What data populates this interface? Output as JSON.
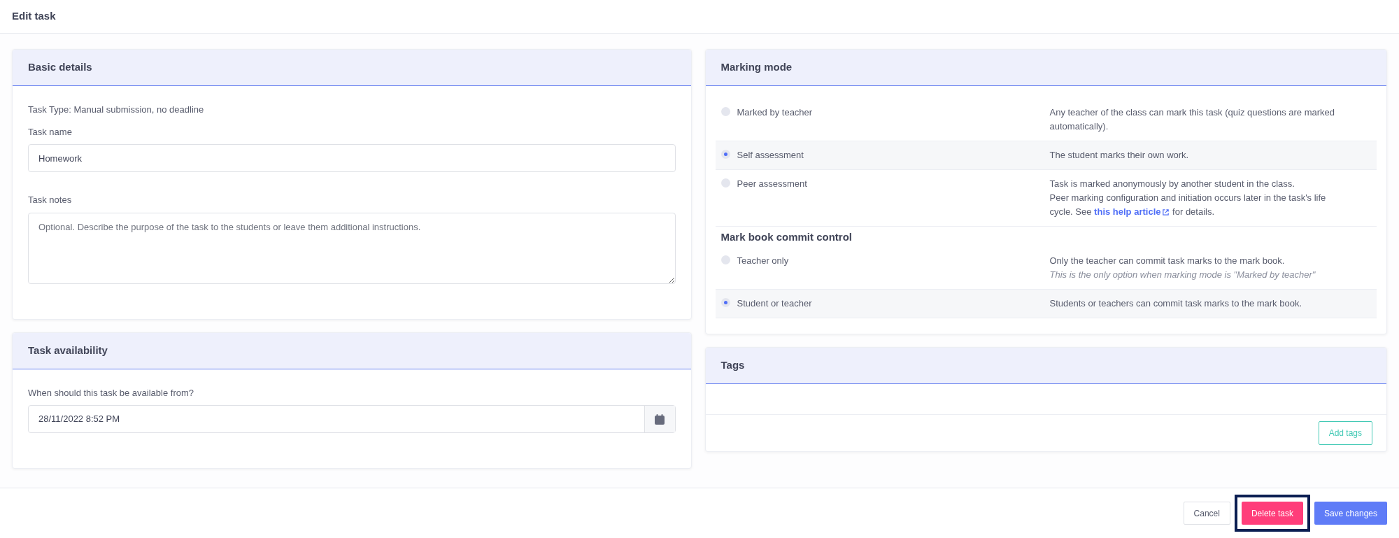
{
  "window": {
    "title": "Edit task"
  },
  "basic_details": {
    "title": "Basic details",
    "task_type": "Task Type: Manual submission, no deadline",
    "name_label": "Task name",
    "name_value": "Homework",
    "notes_label": "Task notes",
    "notes_placeholder": "Optional. Describe the purpose of the task to the students or leave them additional instructions."
  },
  "availability": {
    "title": "Task availability",
    "label": "When should this task be available from?",
    "value": "28/11/2022 8:52 PM"
  },
  "marking_mode": {
    "title": "Marking mode",
    "options": [
      {
        "label": "Marked by teacher",
        "selected": false,
        "description": "Any teacher of the class can mark this task (quiz questions are marked automatically)."
      },
      {
        "label": "Self assessment",
        "selected": true,
        "description": "The student marks their own work."
      },
      {
        "label": "Peer assessment",
        "selected": false,
        "description": "Task is marked anonymously by another student in the class.",
        "description_2": "Peer marking configuration and initiation occurs later in the task's life cycle. See",
        "link": "this help article",
        "description_after": "for details."
      }
    ],
    "commit_title": "Mark book commit control",
    "commit_options": [
      {
        "label": "Teacher only",
        "selected": false,
        "description": "Only the teacher can commit task marks to the mark book.",
        "note": "This is the only option when marking mode is \"Marked by teacher\""
      },
      {
        "label": "Student or teacher",
        "selected": true,
        "description": "Students or teachers can commit task marks to the mark book."
      }
    ]
  },
  "tags": {
    "title": "Tags",
    "add_button": "Add tags"
  },
  "footer": {
    "buttons": [
      {
        "label": "Cancel",
        "kind": "cancel",
        "highlighted": false
      },
      {
        "label": "Delete task",
        "kind": "danger",
        "highlighted": true
      },
      {
        "label": "Save changes",
        "kind": "primary",
        "highlighted": false
      }
    ]
  }
}
